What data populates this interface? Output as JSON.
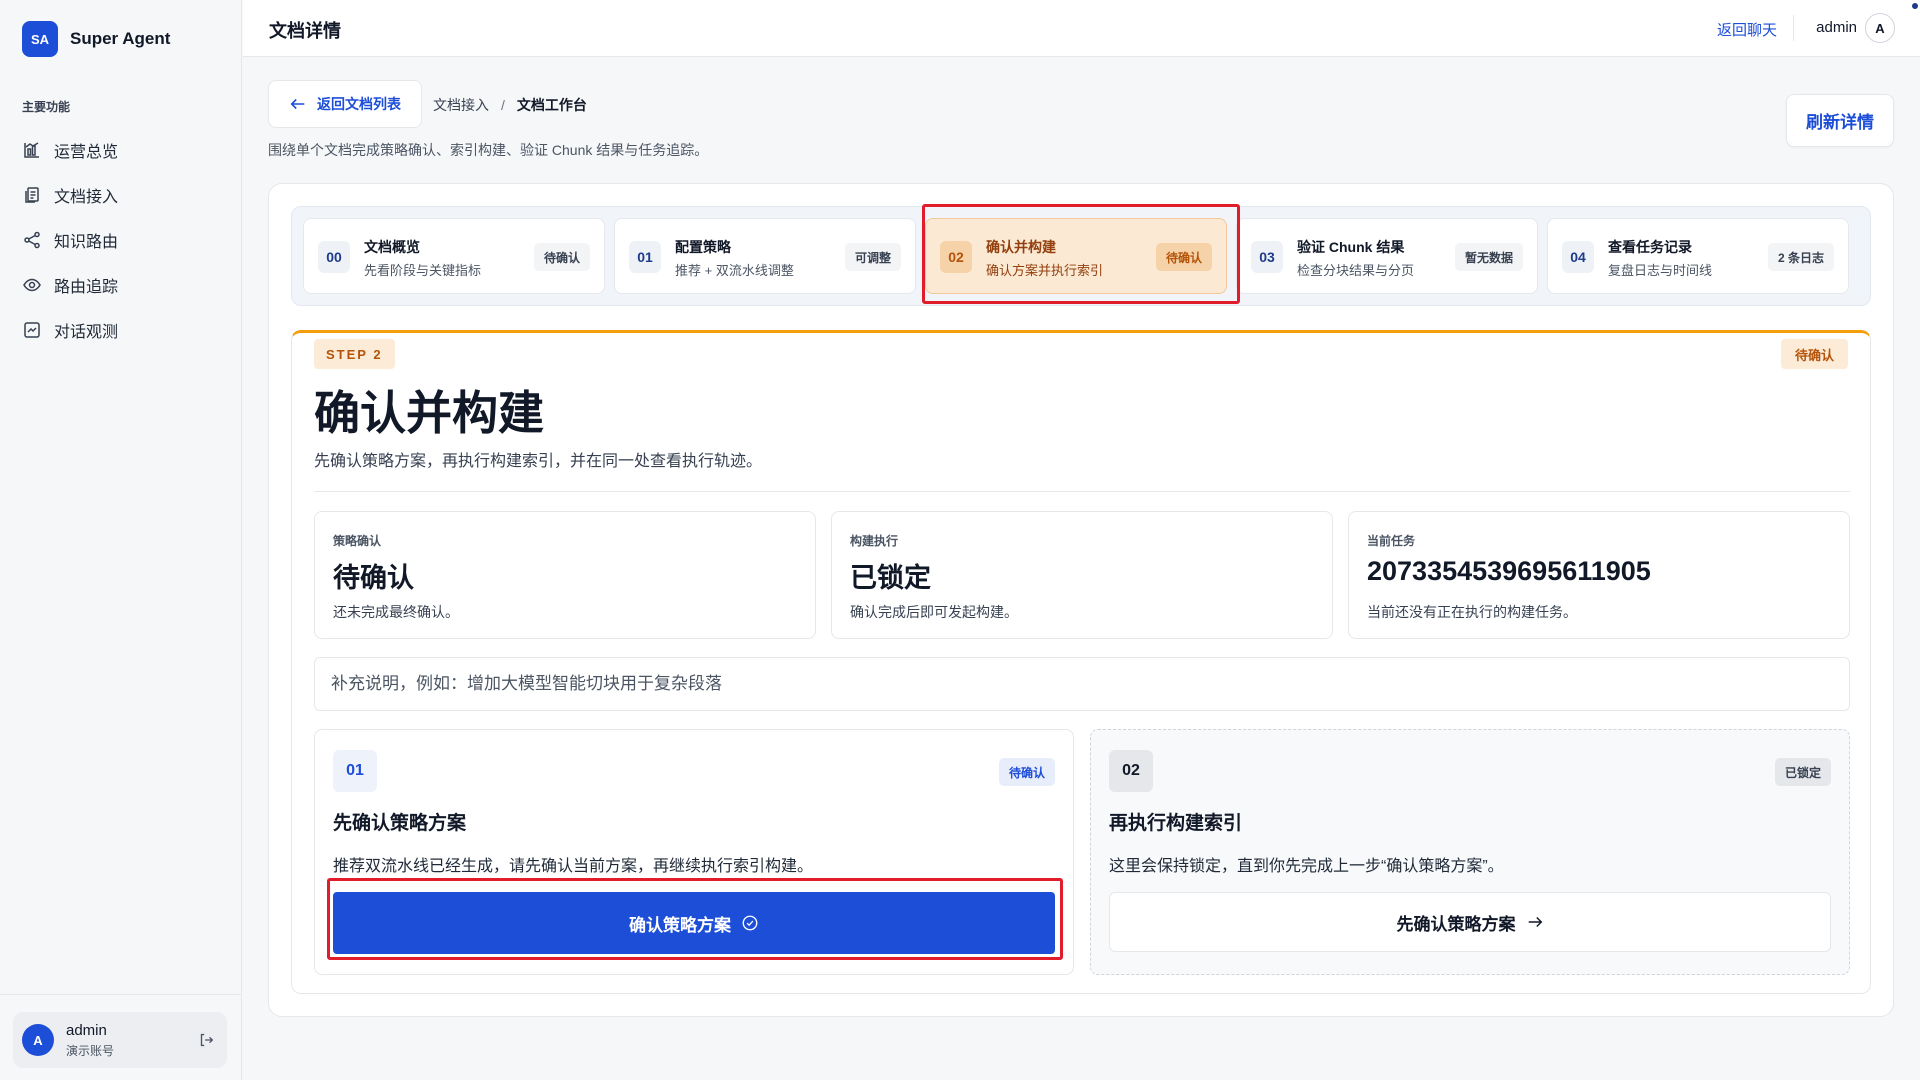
{
  "brand": {
    "logo": "SA",
    "name": "Super Agent"
  },
  "sidebar": {
    "section_title": "主要功能",
    "items": [
      {
        "label": "运营总览",
        "icon": "chart-bar-icon"
      },
      {
        "label": "文档接入",
        "icon": "document-icon"
      },
      {
        "label": "知识路由",
        "icon": "share-icon"
      },
      {
        "label": "路由追踪",
        "icon": "eye-icon"
      },
      {
        "label": "对话观测",
        "icon": "monitor-icon"
      }
    ],
    "user": {
      "avatar": "A",
      "name": "admin",
      "role": "演示账号"
    }
  },
  "topbar": {
    "title": "文档详情",
    "back_chat": "返回聊天",
    "user": "admin",
    "avatar": "A"
  },
  "header": {
    "back_label": "返回文档列表",
    "breadcrumb": [
      "文档接入",
      "文档工作台"
    ],
    "breadcrumb_sep": "/",
    "subtitle": "围绕单个文档完成策略确认、索引构建、验证 Chunk 结果与任务追踪。",
    "refresh_label": "刷新详情"
  },
  "steps": [
    {
      "num": "00",
      "title": "文档概览",
      "desc": "先看阶段与关键指标",
      "badge": "待确认",
      "active": false
    },
    {
      "num": "01",
      "title": "配置策略",
      "desc": "推荐 + 双流水线调整",
      "badge": "可调整",
      "active": false
    },
    {
      "num": "02",
      "title": "确认并构建",
      "desc": "确认方案并执行索引",
      "badge": "待确认",
      "active": true
    },
    {
      "num": "03",
      "title": "验证 Chunk 结果",
      "desc": "检查分块结果与分页",
      "badge": "暂无数据",
      "active": false
    },
    {
      "num": "04",
      "title": "查看任务记录",
      "desc": "复盘日志与时间线",
      "badge": "2 条日志",
      "active": false
    }
  ],
  "content": {
    "step_tag": "STEP 2",
    "status": "待确认",
    "title": "确认并构建",
    "subtitle": "先确认策略方案，再执行构建索引，并在同一处查看执行轨迹。",
    "stats": [
      {
        "label": "策略确认",
        "value": "待确认",
        "note": "还未完成最终确认。"
      },
      {
        "label": "构建执行",
        "value": "已锁定",
        "note": "确认完成后即可发起构建。"
      },
      {
        "label": "当前任务",
        "value": "2073354539695611905",
        "note": "当前还没有正在执行的构建任务。"
      }
    ],
    "note_placeholder": "补充说明，例如：增加大模型智能切块用于复杂段落",
    "note_value": "",
    "actions": [
      {
        "num": "01",
        "badge": "待确认",
        "title": "先确认策略方案",
        "desc": "推荐双流水线已经生成，请先确认当前方案，再继续执行索引构建。",
        "button": "确认策略方案"
      },
      {
        "num": "02",
        "badge": "已锁定",
        "title": "再执行构建索引",
        "desc": "这里会保持锁定，直到你先完成上一步“确认策略方案”。",
        "button": "先确认策略方案"
      }
    ]
  },
  "colors": {
    "accent": "#1d4ed8",
    "warning": "#f59e0b",
    "warning_text": "#b45309",
    "highlight": "#e11d2b"
  }
}
